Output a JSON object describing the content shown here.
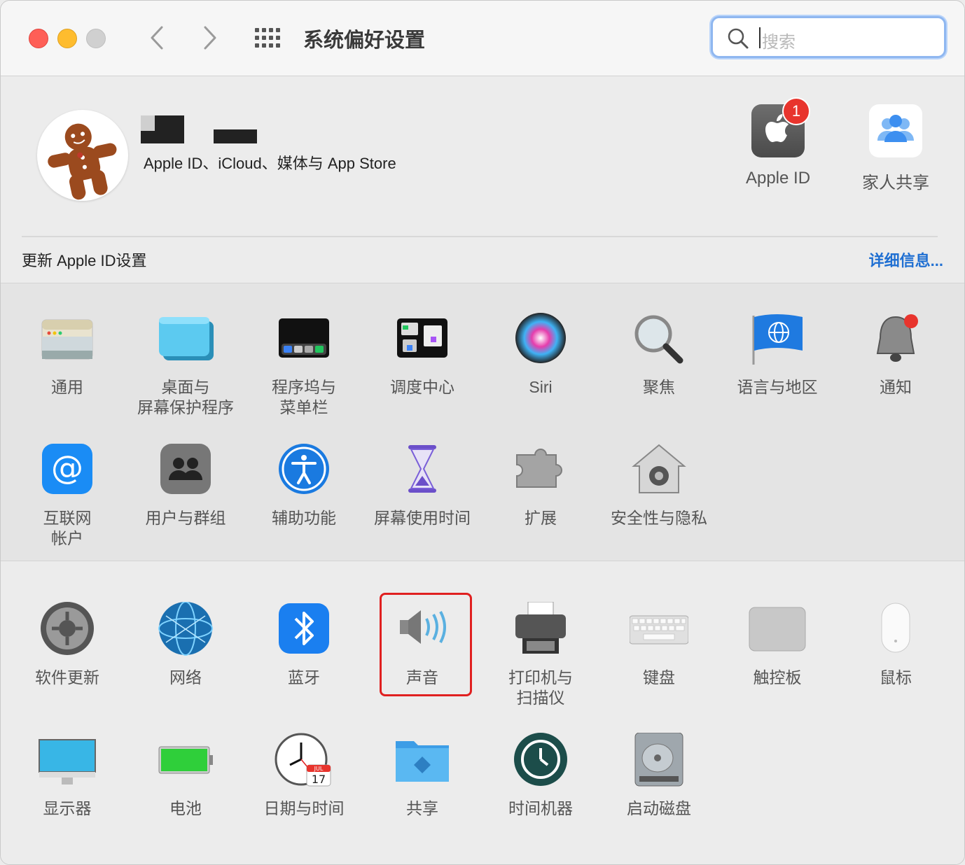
{
  "window": {
    "title": "系统偏好设置",
    "search_placeholder": "搜索"
  },
  "account": {
    "subtitle": "Apple ID、iCloud、媒体与 App Store",
    "apple_id_label": "Apple ID",
    "apple_id_badge": "1",
    "family_label": "家人共享",
    "update_text": "更新 Apple ID设置",
    "details_link": "详细信息..."
  },
  "section1": [
    {
      "label": "通用",
      "icon": "general-icon"
    },
    {
      "label": "桌面与\n屏幕保护程序",
      "icon": "desktop-icon"
    },
    {
      "label": "程序坞与\n菜单栏",
      "icon": "dock-icon"
    },
    {
      "label": "调度中心",
      "icon": "mission-control-icon"
    },
    {
      "label": "Siri",
      "icon": "siri-icon"
    },
    {
      "label": "聚焦",
      "icon": "spotlight-icon"
    },
    {
      "label": "语言与地区",
      "icon": "language-icon"
    },
    {
      "label": "通知",
      "icon": "notifications-icon"
    },
    {
      "label": "互联网\n帐户",
      "icon": "internet-accounts-icon"
    },
    {
      "label": "用户与群组",
      "icon": "users-icon"
    },
    {
      "label": "辅助功能",
      "icon": "accessibility-icon"
    },
    {
      "label": "屏幕使用时间",
      "icon": "screen-time-icon"
    },
    {
      "label": "扩展",
      "icon": "extensions-icon"
    },
    {
      "label": "安全性与隐私",
      "icon": "security-icon"
    }
  ],
  "section2": [
    {
      "label": "软件更新",
      "icon": "software-update-icon"
    },
    {
      "label": "网络",
      "icon": "network-icon"
    },
    {
      "label": "蓝牙",
      "icon": "bluetooth-icon"
    },
    {
      "label": "声音",
      "icon": "sound-icon"
    },
    {
      "label": "打印机与\n扫描仪",
      "icon": "printer-icon"
    },
    {
      "label": "键盘",
      "icon": "keyboard-icon"
    },
    {
      "label": "触控板",
      "icon": "trackpad-icon"
    },
    {
      "label": "鼠标",
      "icon": "mouse-icon"
    },
    {
      "label": "显示器",
      "icon": "display-icon"
    },
    {
      "label": "电池",
      "icon": "battery-icon"
    },
    {
      "label": "日期与时间",
      "icon": "date-time-icon"
    },
    {
      "label": "共享",
      "icon": "sharing-icon"
    },
    {
      "label": "时间机器",
      "icon": "time-machine-icon"
    },
    {
      "label": "启动磁盘",
      "icon": "startup-disk-icon"
    }
  ],
  "clock_calendar": {
    "month": "JUL",
    "day": "17"
  },
  "colors": {
    "accent": "#1f6fd2",
    "highlight": "#e02020"
  }
}
